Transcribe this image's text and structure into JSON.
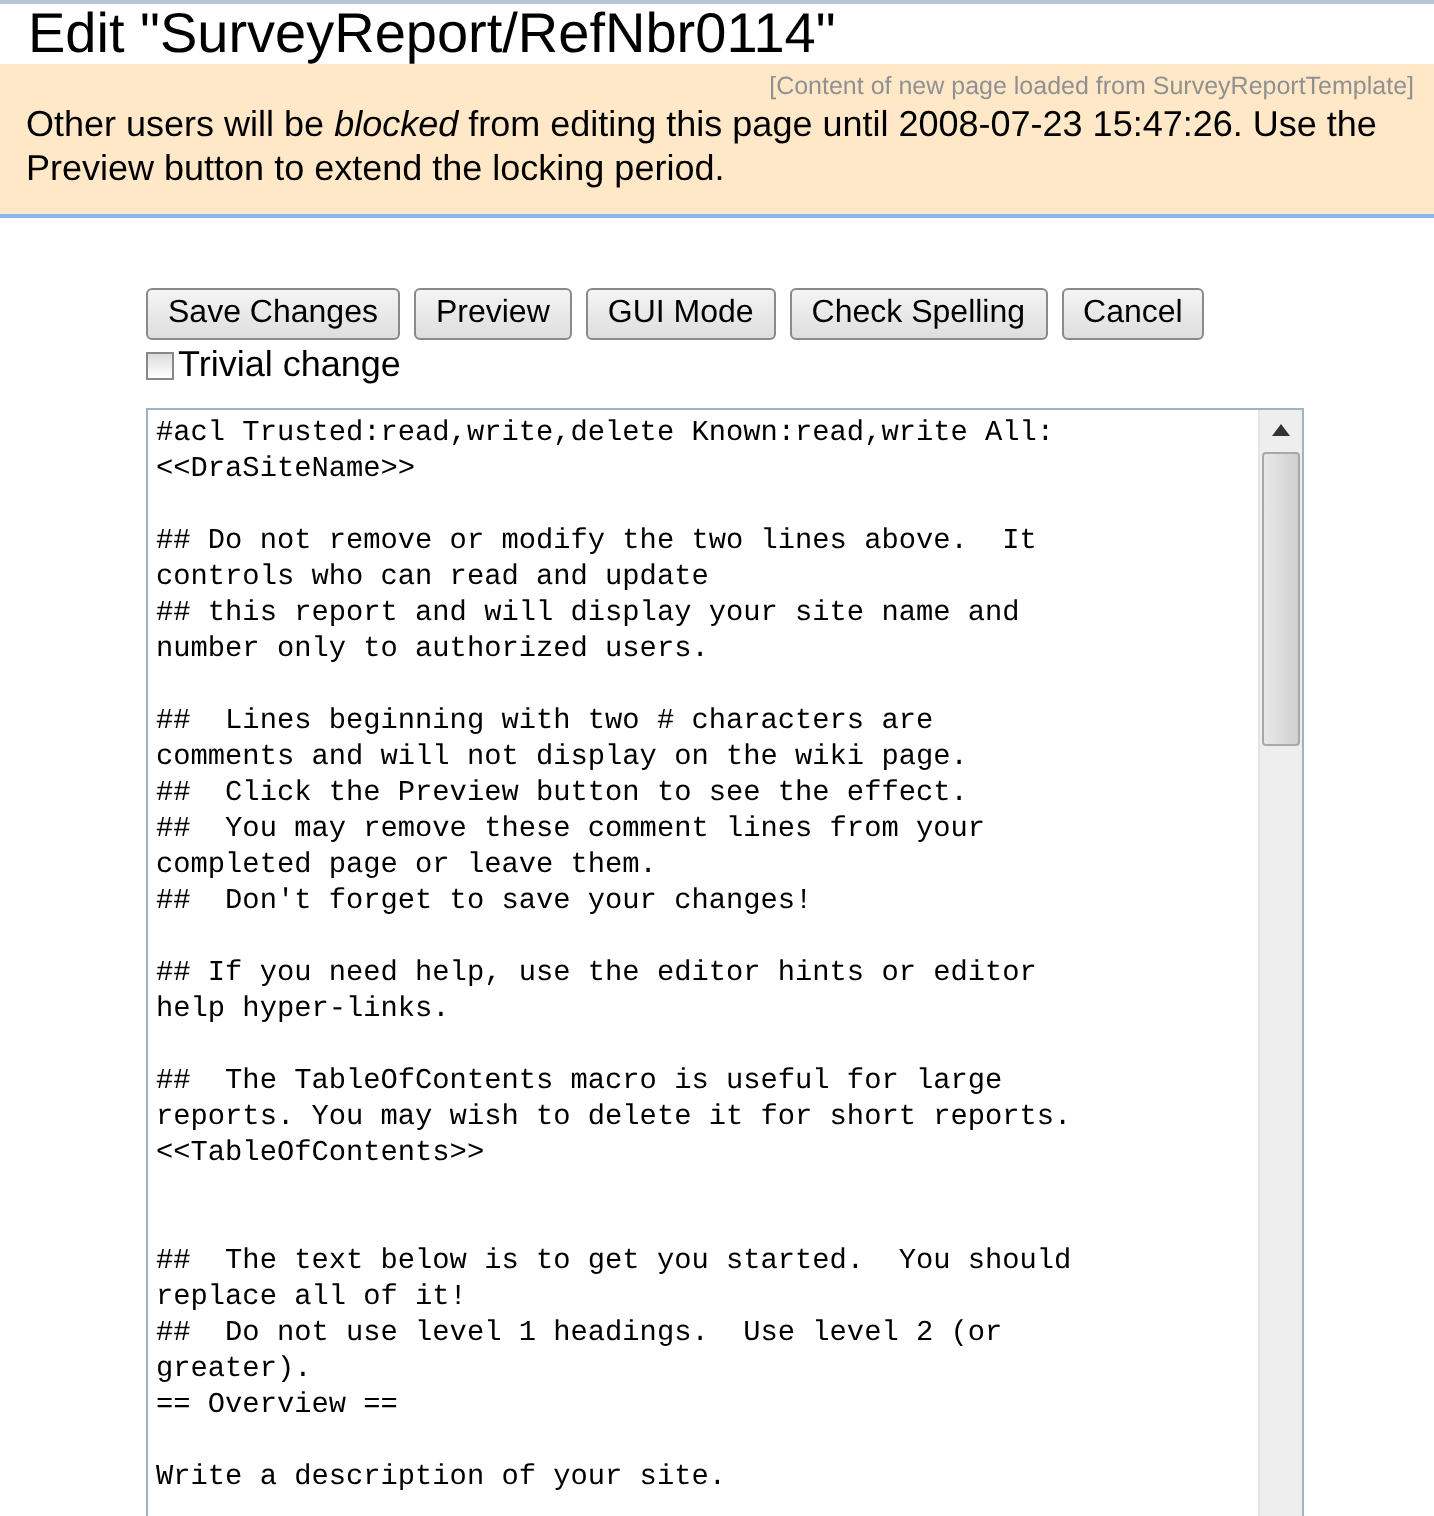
{
  "title": "Edit \"SurveyReport/RefNbr0114\"",
  "banner": {
    "message": "Other users will be *blocked* from editing this page until 2008-07-23 15:47:26. Use the Preview button to extend the locking period.",
    "note": "[Content of new page loaded from SurveyReportTemplate]"
  },
  "buttons": [
    "Save Changes",
    "Preview",
    "GUI Mode",
    "Check Spelling",
    "Cancel"
  ],
  "trivial_change": {
    "label": "Trivial change",
    "checked": false
  },
  "editor": {
    "value": "#acl Trusted:read,write,delete Known:read,write All:\n<<DraSiteName>>\n\n## Do not remove or modify the two lines above.  It\ncontrols who can read and update\n## this report and will display your site name and\nnumber only to authorized users.\n\n##  Lines beginning with two # characters are\ncomments and will not display on the wiki page.\n##  Click the Preview button to see the effect.\n##  You may remove these comment lines from your\ncompleted page or leave them.\n##  Don't forget to save your changes!\n\n## If you need help, use the editor hints or editor\nhelp hyper-links.\n\n##  The TableOfContents macro is useful for large\nreports. You may wish to delete it for short reports.\n<<TableOfContents>>\n\n\n##  The text below is to get you started.  You should\nreplace all of it!\n##  Do not use level 1 headings.  Use level 2 (or\ngreater).\n== Overview ==\n\nWrite a description of your site."
  }
}
